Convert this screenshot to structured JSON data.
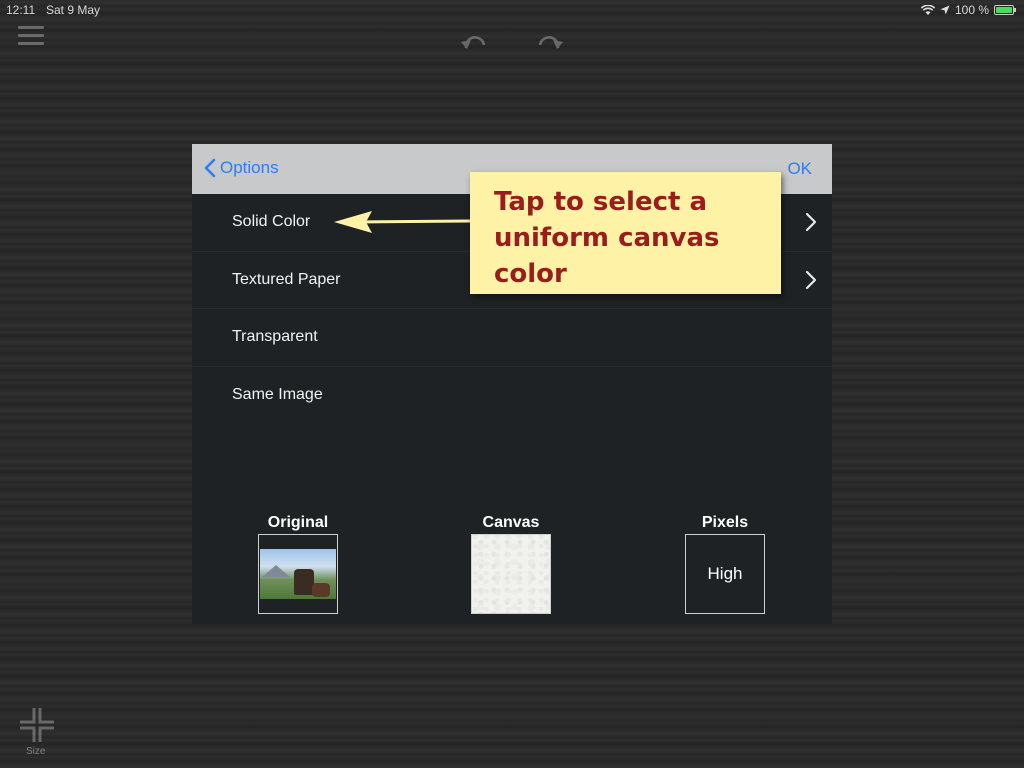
{
  "status_bar": {
    "time": "12:11",
    "date": "Sat 9 May",
    "battery": "100 %",
    "icons": [
      "wifi-icon",
      "location-icon",
      "battery-icon"
    ]
  },
  "toolbar": {
    "icons": [
      "menu-icon",
      "undo-icon",
      "redo-icon"
    ]
  },
  "dialog": {
    "back_label": "Options",
    "ok_label": "OK",
    "options": [
      {
        "label": "Solid Color",
        "has_chevron": true
      },
      {
        "label": "Textured Paper",
        "has_chevron": true
      },
      {
        "label": "Transparent",
        "has_chevron": false
      },
      {
        "label": "Same Image",
        "has_chevron": false
      }
    ],
    "thumbnails": {
      "original_title": "Original",
      "canvas_title": "Canvas",
      "pixels_title": "Pixels",
      "pixels_value": "High"
    }
  },
  "callout": {
    "line1": "Tap to select a",
    "line2": "uniform canvas",
    "line3": "color"
  },
  "bottom": {
    "size_label": "Size"
  },
  "colors": {
    "accent": "#2f7cf6",
    "callout_bg": "#fdf2a6",
    "callout_text": "#9b1c1c",
    "dialog_bg": "#1e2225",
    "header_bg": "#c8c9cb"
  }
}
